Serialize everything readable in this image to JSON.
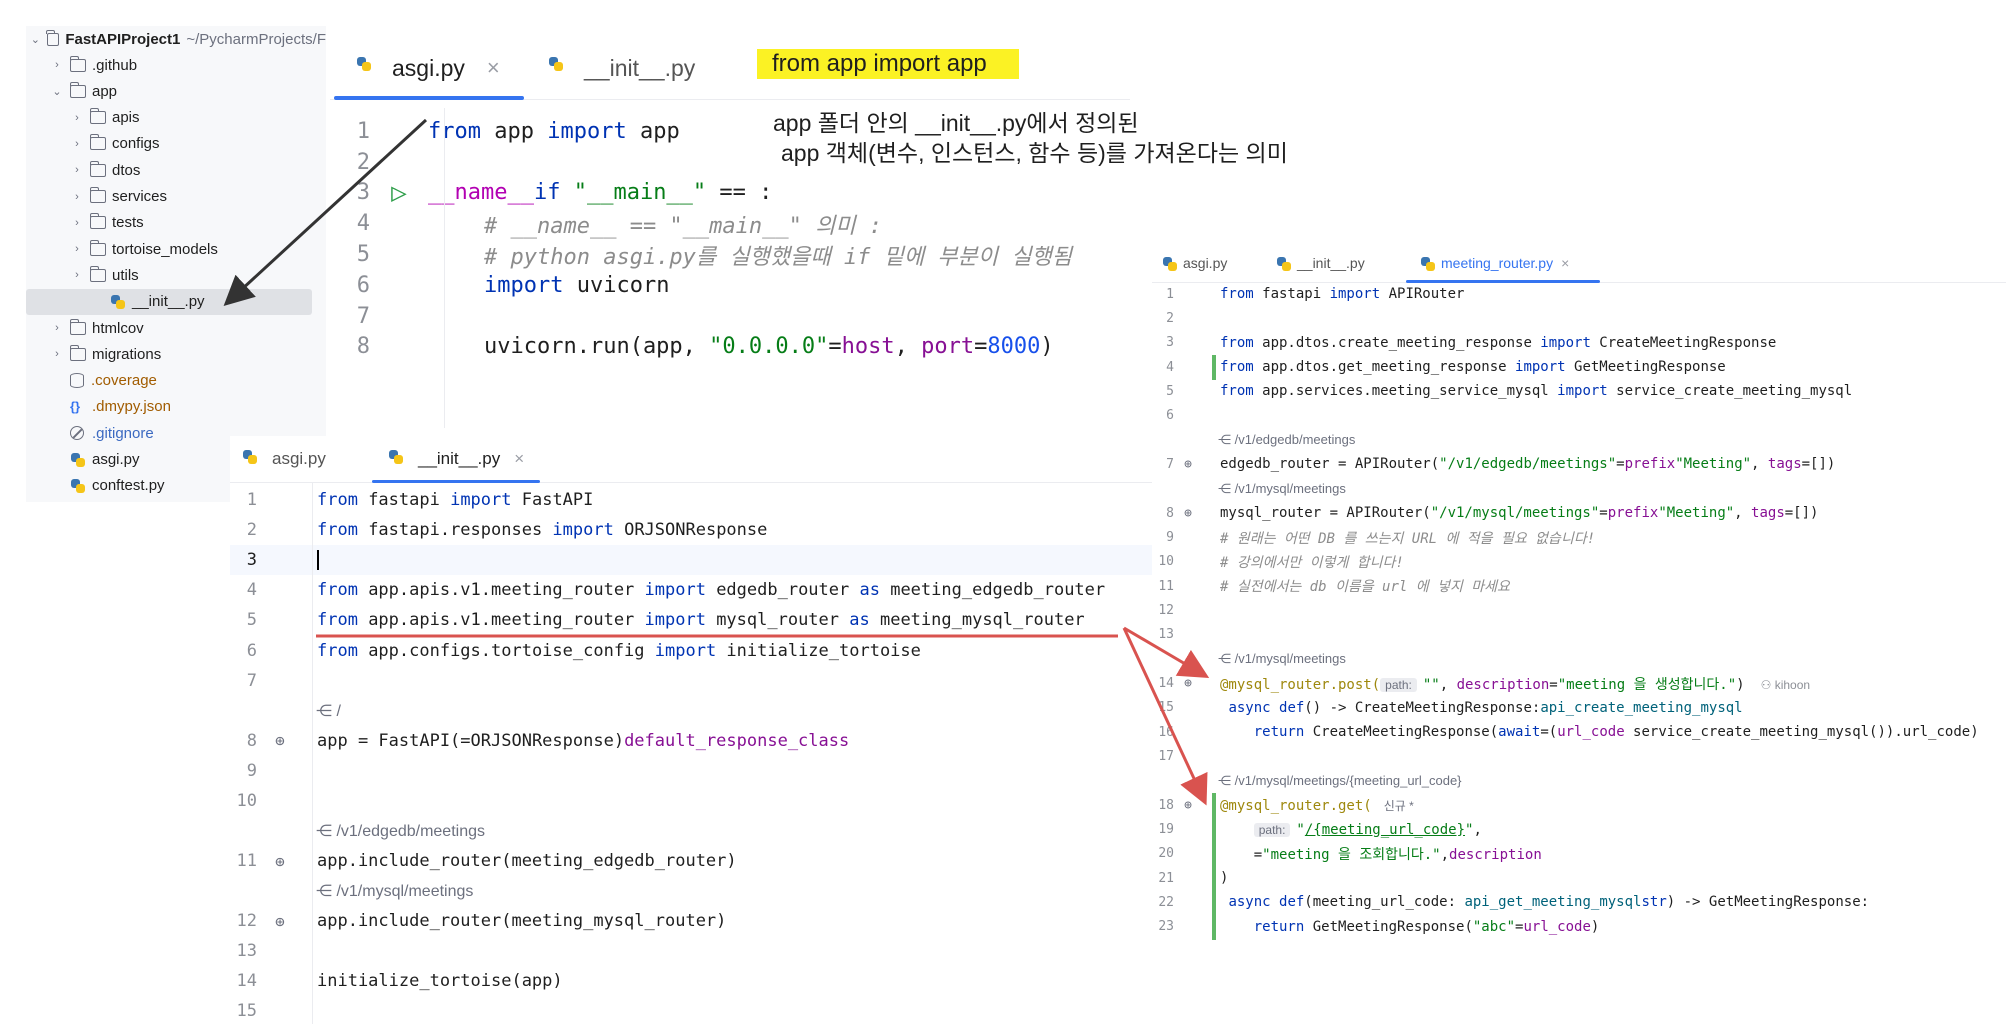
{
  "tree": {
    "root_name": "FastAPIProject1",
    "root_path": "~/PycharmProjects/F",
    "items": [
      {
        "label": ".github",
        "type": "folder",
        "chev": "›"
      },
      {
        "label": "app",
        "type": "folder",
        "chev": "⌄"
      },
      {
        "label": "apis",
        "type": "folder",
        "chev": "›"
      },
      {
        "label": "configs",
        "type": "folder",
        "chev": "›"
      },
      {
        "label": "dtos",
        "type": "folder",
        "chev": "›"
      },
      {
        "label": "services",
        "type": "folder",
        "chev": "›"
      },
      {
        "label": "tests",
        "type": "folder",
        "chev": "›"
      },
      {
        "label": "tortoise_models",
        "type": "folder",
        "chev": "›"
      },
      {
        "label": "utils",
        "type": "folder",
        "chev": "›"
      },
      {
        "label": "__init__.py",
        "type": "python"
      },
      {
        "label": "htmlcov",
        "type": "folder",
        "chev": "›"
      },
      {
        "label": "migrations",
        "type": "folder",
        "chev": "›"
      },
      {
        "label": ".coverage",
        "type": "db"
      },
      {
        "label": ".dmypy.json",
        "type": "json",
        "icon": "{}"
      },
      {
        "label": ".gitignore",
        "type": "ignore"
      },
      {
        "label": "asgi.py",
        "type": "python"
      },
      {
        "label": "conftest.py",
        "type": "python"
      }
    ]
  },
  "annotations": {
    "yellow": "from app import app",
    "line1": "app 폴더 안의 __init__.py에서 정의된",
    "line2": "app 객체(변수, 인스턴스, 함수 등)를 가져온다는 의미"
  },
  "colors": {
    "accent": "#3574f0",
    "arrow": "#d9534f",
    "arrow_dark": "#333333",
    "highlight": "#fbf224",
    "change_bar": "#5fb865"
  },
  "editor1": {
    "tabs": [
      "asgi.py",
      "__init__.py"
    ],
    "close_glyph": "×",
    "run_icon": "▷",
    "line_numbers": [
      "1",
      "2",
      "3",
      "4",
      "5",
      "6",
      "7",
      "8"
    ],
    "code": [
      {
        "k1": "from",
        "t1": " app ",
        "k2": "import",
        "t2": " app"
      },
      {},
      {
        "k1": "if",
        "t1": " ",
        "d1": "__name__",
        "t2": " == ",
        "s1": "\"__main__\"",
        "t3": ":"
      },
      {
        "c": "# __name__ == \"__main__\" 의미 :"
      },
      {
        "c": "# python asgi.py를 실행했을때 if 밑에 부분이 실행됨"
      },
      {
        "k1": "import",
        "t1": " uvicorn"
      },
      {},
      {
        "t1": "uvicorn.run(app, ",
        "p1": "host",
        "t2": "=",
        "s1": "\"0.0.0.0\"",
        "t3": ", ",
        "p2": "port",
        "t4": "=",
        "n1": "8000",
        "t5": ")"
      }
    ]
  },
  "editor2": {
    "tabs": [
      "asgi.py",
      "__init__.py"
    ],
    "close_glyph": "×",
    "line_numbers": [
      "1",
      "2",
      "3",
      "4",
      "5",
      "6",
      "7",
      "8",
      "9",
      "10",
      "11",
      "12",
      "13",
      "14",
      "15"
    ],
    "hints": [
      "/",
      "/v1/edgedb/meetings",
      "/v1/mysql/meetings"
    ],
    "code": {
      "l1": {
        "k1": "from",
        "t1": " fastapi ",
        "k2": "import",
        "t2": " FastAPI"
      },
      "l2": {
        "k1": "from",
        "t1": " fastapi.responses ",
        "k2": "import",
        "t2": " ORJSONResponse"
      },
      "l4": {
        "k1": "from",
        "t1": " app.apis.v1.meeting_router ",
        "k2": "import",
        "t2": " edgedb_router ",
        "k3": "as",
        "t3": " meeting_edgedb_router"
      },
      "l5": {
        "k1": "from",
        "t1": " app.apis.v1.meeting_router ",
        "k2": "import",
        "t2": " mysql_router ",
        "k3": "as",
        "t3": " meeting_mysql_router"
      },
      "l6": {
        "k1": "from",
        "t1": " app.configs.tortoise_config ",
        "k2": "import",
        "t2": " initialize_tortoise"
      },
      "l8": {
        "t1": "app = FastAPI(",
        "p1": "default_response_class",
        "t2": "=ORJSONResponse)"
      },
      "l11": {
        "t1": "app.include_router(meeting_edgedb_router)"
      },
      "l12": {
        "t1": "app.include_router(meeting_mysql_router)"
      },
      "l14": {
        "t1": "initialize_tortoise(app)"
      }
    }
  },
  "editor3": {
    "tabs": [
      "asgi.py",
      "__init__.py",
      "meeting_router.py"
    ],
    "close_glyph": "×",
    "line_numbers": [
      "1",
      "2",
      "3",
      "4",
      "5",
      "6",
      "7",
      "8",
      "9",
      "10",
      "11",
      "12",
      "13",
      "14",
      "15",
      "16",
      "17",
      "18",
      "19",
      "20",
      "21",
      "22",
      "23"
    ],
    "hints": [
      "/v1/edgedb/meetings",
      "/v1/mysql/meetings",
      "/v1/mysql/meetings",
      "/v1/mysql/meetings/{meeting_url_code}"
    ],
    "author": "kihoon",
    "new_badge": "신규 *",
    "path_label": "path:",
    "code": {
      "l1": {
        "k1": "from",
        "t1": " fastapi ",
        "k2": "import",
        "t2": " APIRouter"
      },
      "l3": {
        "k1": "from",
        "t1": " app.dtos.create_meeting_response ",
        "k2": "import",
        "t2": " CreateMeetingResponse"
      },
      "l4": {
        "k1": "from",
        "t1": " app.dtos.get_meeting_response ",
        "k2": "import",
        "t2": " GetMeetingResponse"
      },
      "l5": {
        "k1": "from",
        "t1": " app.services.meeting_service_mysql ",
        "k2": "import",
        "t2": " service_create_meeting_mysql"
      },
      "l7": {
        "t1": "edgedb_router = APIRouter(",
        "p1": "prefix",
        "t2": "=",
        "s1": "\"/v1/edgedb/meetings\"",
        "t3": ", ",
        "p2": "tags",
        "t4": "=[",
        "s2": "\"Meeting\"",
        "t5": "])"
      },
      "l8": {
        "t1": "mysql_router = APIRouter(",
        "p1": "prefix",
        "t2": "=",
        "s1": "\"/v1/mysql/meetings\"",
        "t3": ", ",
        "p2": "tags",
        "t4": "=[",
        "s2": "\"Meeting\"",
        "t5": "])"
      },
      "l9": {
        "c": "# 원래는 어떤 DB 를 쓰는지 URL 에 적을 필요 없습니다!"
      },
      "l10": {
        "c": "# 강의에서만 이렇게 합니다!"
      },
      "l11": {
        "c": "# 실전에서는 db 이름을 url 에 넣지 마세요"
      },
      "l14": {
        "d1": "@mysql_router.post(",
        "s1": "\"\"",
        "t1": ", ",
        "p1": "description",
        "t2": "=",
        "s2": "\"meeting 을 생성합니다.\"",
        "t3": ")"
      },
      "l15": {
        "k1": "async def",
        "t0": " ",
        "f1": "api_create_meeting_mysql",
        "t1": "() -> CreateMeetingResponse:"
      },
      "l16": {
        "t0": "    ",
        "k1": "return",
        "t1": " CreateMeetingResponse(",
        "p1": "url_code",
        "t2": "=(",
        "k2": "await",
        "t3": " service_create_meeting_mysql()).url_code)"
      },
      "l18": {
        "d1": "@mysql_router.get("
      },
      "l19": {
        "s1": "\"",
        "s2": "/{meeting_url_code}",
        "s3": "\"",
        "t1": ","
      },
      "l20": {
        "t0": "    ",
        "p1": "description",
        "t1": "=",
        "s1": "\"meeting 을 조회합니다.\"",
        "t2": ","
      },
      "l21": {
        "t1": ")"
      },
      "l22": {
        "k1": "async def",
        "t0": " ",
        "f1": "api_get_meeting_mysql",
        "t1": "(meeting_url_code: ",
        "k2": "str",
        "t2": ") -> GetMeetingResponse:"
      },
      "l23": {
        "t0": "    ",
        "k1": "return",
        "t1": " GetMeetingResponse(",
        "p1": "url_code",
        "t2": "=",
        "s1": "\"abc\"",
        "t3": ")"
      }
    }
  }
}
